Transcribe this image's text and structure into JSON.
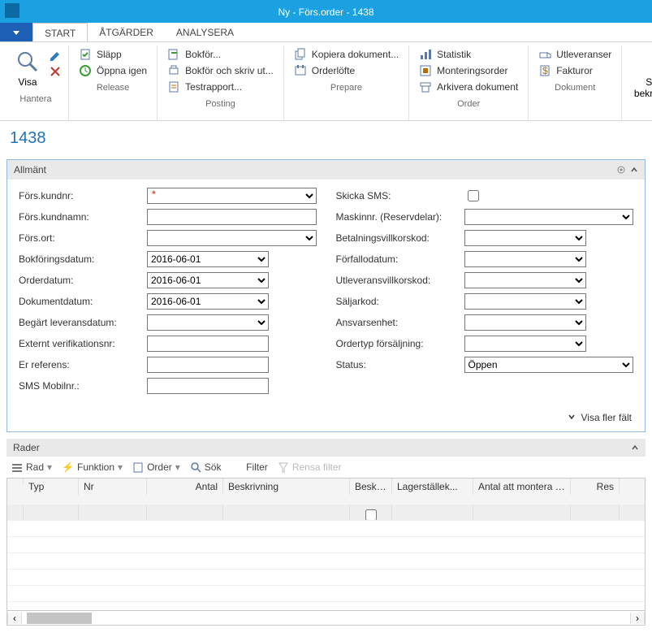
{
  "window": {
    "title": "Ny - Förs.order - 1438"
  },
  "menu": {
    "tabs": [
      "START",
      "ÅTGÄRDER",
      "ANALYSERA"
    ],
    "active": 0
  },
  "ribbon": {
    "groups": [
      {
        "caption": "Hantera",
        "big": {
          "label": "Visa"
        }
      },
      {
        "caption": "Release",
        "items": [
          "Släpp",
          "Öppna igen"
        ]
      },
      {
        "caption": "Posting",
        "items": [
          "Bokför...",
          "Bokför och skriv ut...",
          "Testrapport..."
        ]
      },
      {
        "caption": "Prepare",
        "items": [
          "Kopiera dokument...",
          "Orderlöfte"
        ]
      },
      {
        "caption": "Order",
        "items": [
          "Statistik",
          "Monteringsorder",
          "Arkivera dokument"
        ]
      },
      {
        "caption": "Dokument",
        "items": [
          "Utleveranser",
          "Fakturor"
        ]
      },
      {
        "caption": "Print",
        "big": {
          "label": "Skriv ut bekräftelse..."
        }
      }
    ]
  },
  "page_number": "1438",
  "general": {
    "header": "Allmänt",
    "more_fields": "Visa fler fält",
    "left": {
      "labels": {
        "kundnr": "Förs.kundnr:",
        "kundnamn": "Förs.kundnamn:",
        "ort": "Förs.ort:",
        "bokfdatum": "Bokföringsdatum:",
        "orderdatum": "Orderdatum:",
        "dokdatum": "Dokumentdatum:",
        "levdatum": "Begärt leveransdatum:",
        "extver": "Externt verifikationsnr:",
        "erref": "Er referens:",
        "sms": "SMS Mobilnr.:"
      },
      "values": {
        "kundnr": "",
        "kundnamn": "",
        "ort": "",
        "bokfdatum": "2016-06-01",
        "orderdatum": "2016-06-01",
        "dokdatum": "2016-06-01",
        "levdatum": "",
        "extver": "",
        "erref": "",
        "sms": ""
      }
    },
    "right": {
      "labels": {
        "skickasms": "Skicka SMS:",
        "maskin": "Maskinnr. (Reservdelar):",
        "betvillkor": "Betalningsvillkorskod:",
        "forfall": "Förfallodatum:",
        "utlev": "Utleveransvillkorskod:",
        "saljarkod": "Säljarkod:",
        "ansvar": "Ansvarsenhet:",
        "ordertyp": "Ordertyp försäljning:",
        "status": "Status:"
      },
      "values": {
        "skickasms": false,
        "maskin": "",
        "betvillkor": "",
        "forfall": "",
        "utlev": "",
        "saljarkod": "",
        "ansvar": "",
        "ordertyp": "",
        "status": "Öppen"
      }
    }
  },
  "lines": {
    "header": "Rader",
    "toolbar": {
      "rad": "Rad",
      "funktion": "Funktion",
      "order": "Order",
      "sok": "Sök",
      "filter": "Filter",
      "rensa": "Rensa filter"
    },
    "columns": {
      "typ": "Typ",
      "nr": "Nr",
      "antal": "Antal",
      "besk": "Beskrivning",
      "beskf": "Besk... Fet",
      "lager": "Lagerställek...",
      "antatt": "Antal att montera m...",
      "res": "Res"
    }
  }
}
